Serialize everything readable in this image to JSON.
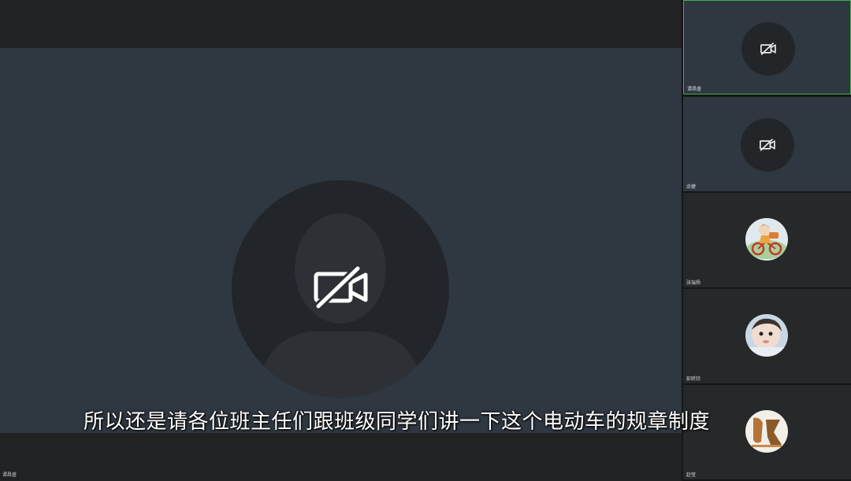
{
  "main": {
    "speaker_name": "谭昌盛",
    "camera_status_icon": "camera-off-icon"
  },
  "subtitle": "所以还是请各位班主任们跟班级同学们讲一下这个电动车的规章制度",
  "participants": [
    {
      "name": "谭昌盛",
      "avatar": "camera-off-icon",
      "active": true
    },
    {
      "name": "余婕",
      "avatar": "camera-off-icon",
      "active": false
    },
    {
      "name": "张瑞杨",
      "avatar": "cartoon-girl-bicycle",
      "active": false
    },
    {
      "name": "彭昕欣",
      "avatar": "baby-photo",
      "active": false
    },
    {
      "name": "赵莹",
      "avatar": "character-logo",
      "active": false
    }
  ]
}
